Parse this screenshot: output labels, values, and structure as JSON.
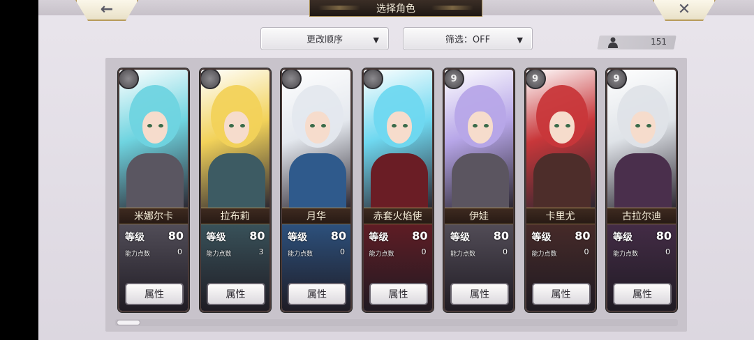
{
  "header": {
    "back_icon": "back-arrow-icon",
    "title": "选择角色",
    "close_icon": "close-x-icon"
  },
  "controls": {
    "order_label": "更改顺序",
    "filter_label": "筛选：OFF",
    "caret": "▼"
  },
  "roster_count": {
    "icon": "person-icon",
    "value": "151"
  },
  "stat_labels": {
    "level": "等级",
    "ability_points": "能力点数",
    "attribute_button": "属性"
  },
  "characters": [
    {
      "name": "米娜尔卡",
      "level": "80",
      "ability_points": "0",
      "badge": "",
      "accent": "#6fd4e0",
      "lower_tint": "#5a5661"
    },
    {
      "name": "拉布莉",
      "level": "80",
      "ability_points": "3",
      "badge": "",
      "accent": "#f2d25a",
      "lower_tint": "#3d5b63"
    },
    {
      "name": "月华",
      "level": "80",
      "ability_points": "0",
      "badge": "",
      "accent": "#e4e8ee",
      "lower_tint": "#2f5a8c"
    },
    {
      "name": "赤套火焰使",
      "level": "80",
      "ability_points": "0",
      "badge": "",
      "accent": "#6fd8f0",
      "lower_tint": "#6a1d25"
    },
    {
      "name": "伊娃",
      "level": "80",
      "ability_points": "0",
      "badge": "9",
      "accent": "#b7a6e8",
      "lower_tint": "#5b5560"
    },
    {
      "name": "卡里尤",
      "level": "80",
      "ability_points": "0",
      "badge": "9",
      "accent": "#c8373a",
      "lower_tint": "#4d2d2a"
    },
    {
      "name": "古拉尔迪",
      "level": "80",
      "ability_points": "0",
      "badge": "9",
      "accent": "#dfe3e8",
      "lower_tint": "#4a2f4c"
    }
  ]
}
